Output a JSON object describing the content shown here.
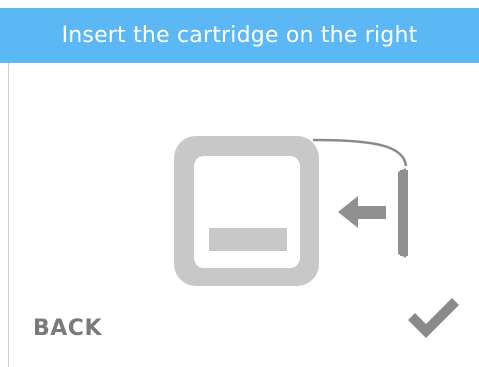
{
  "header": {
    "title": "Insert the cartridge on the right"
  },
  "footer": {
    "back_label": "BACK",
    "confirm_icon": "checkmark-icon"
  },
  "illustration": {
    "cartridge_icon": "cartridge-icon",
    "arrow_icon": "arrow-left-icon",
    "slot_icon": "cartridge-slot-icon"
  },
  "colors": {
    "header_bg": "#5cb8f5",
    "header_text": "#ffffff",
    "illustration_gray": "#c8c8c8",
    "dark_gray": "#7a7a7a"
  }
}
